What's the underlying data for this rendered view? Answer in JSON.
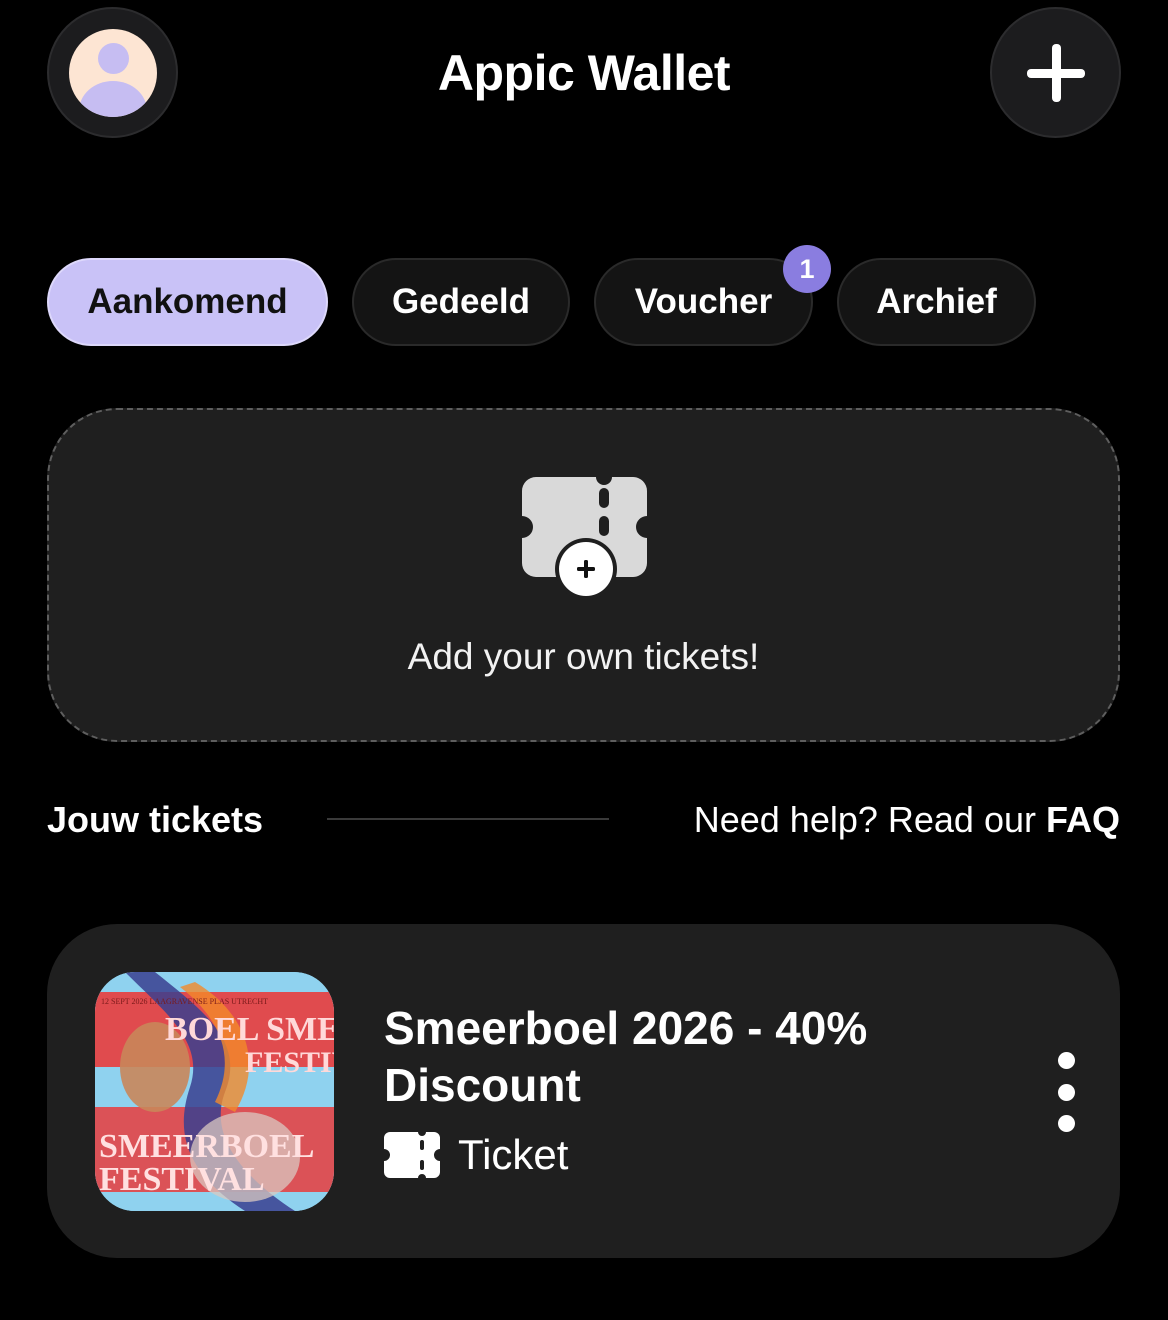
{
  "header": {
    "title": "Appic Wallet",
    "avatar_icon": "user-avatar-icon",
    "add_icon": "plus-icon"
  },
  "tabs": [
    {
      "label": "Aankomend",
      "active": true
    },
    {
      "label": "Gedeeld",
      "active": false
    },
    {
      "label": "Voucher",
      "active": false,
      "badge": "1"
    },
    {
      "label": "Archief",
      "active": false
    }
  ],
  "add_card": {
    "text": "Add your own tickets!",
    "icon": "add-ticket-icon"
  },
  "section": {
    "title": "Jouw tickets",
    "help_text": "Need help? Read our ",
    "help_link": "FAQ"
  },
  "tickets": [
    {
      "name": "Smeerboel 2026 - 40% Discount",
      "type": "Ticket",
      "type_icon": "ticket-icon",
      "menu_icon": "more-vertical-icon",
      "poster": {
        "top_small": "12 SEPT 2026 LAAGRAVENSE PLAS UTRECHT",
        "line1": "BOEL SME",
        "line2": "FESTIV",
        "line3": "SMEERBOEL",
        "line4": "FESTIVAL"
      }
    }
  ],
  "colors": {
    "background": "#000000",
    "surface": "#1f1f1f",
    "accent": "#c9c2f7",
    "badge": "#8a7de0"
  }
}
